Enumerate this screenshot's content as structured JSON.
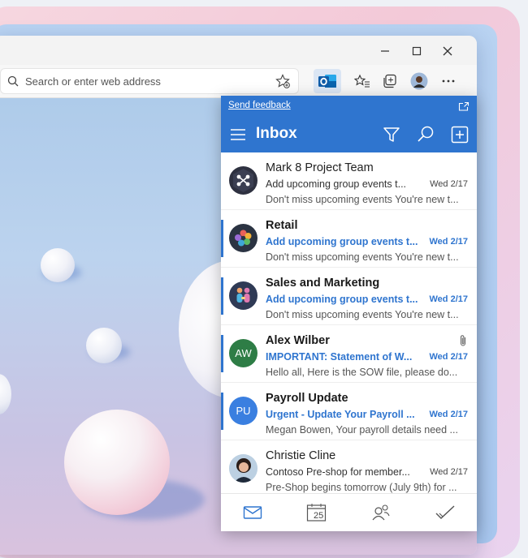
{
  "browser": {
    "address_placeholder": "Search or enter web address",
    "window_controls": [
      "minimize-icon",
      "maximize-icon",
      "close-icon"
    ],
    "toolbar_icons": [
      "outlook-extension-icon",
      "favorites-icon",
      "collections-icon",
      "profile-avatar",
      "more-icon"
    ]
  },
  "panel": {
    "feedback_link": "Send feedback",
    "title": "Inbox",
    "accent_color": "#2f75cf"
  },
  "mails": [
    {
      "sender": "Mark 8 Project Team",
      "subject": "Add upcoming group events t...",
      "date": "Wed 2/17",
      "preview": "Don't miss upcoming events You're new t...",
      "unread": false,
      "avatar": "team-logo",
      "initials": ""
    },
    {
      "sender": "Retail",
      "subject": "Add upcoming group events t...",
      "date": "Wed 2/17",
      "preview": "Don't miss upcoming events You're new t...",
      "unread": true,
      "avatar": "retail-logo",
      "initials": ""
    },
    {
      "sender": "Sales and Marketing",
      "subject": "Add upcoming group events t...",
      "date": "Wed 2/17",
      "preview": "Don't miss upcoming events You're new t...",
      "unread": true,
      "avatar": "sales-logo",
      "initials": ""
    },
    {
      "sender": "Alex Wilber",
      "subject": "IMPORTANT: Statement of W...",
      "date": "Wed 2/17",
      "preview": "Hello all, Here is the SOW file, please do...",
      "unread": true,
      "avatar": "initials",
      "initials": "AW",
      "avatar_color": "#2e7d46",
      "attachment": true
    },
    {
      "sender": "Payroll Update",
      "subject": "Urgent - Update Your Payroll ...",
      "date": "Wed 2/17",
      "preview": "Megan Bowen, Your payroll details need ...",
      "unread": true,
      "avatar": "initials",
      "initials": "PU",
      "avatar_color": "#3a7fe0"
    },
    {
      "sender": "Christie Cline",
      "subject": "Contoso Pre-shop for member...",
      "date": "Wed 2/17",
      "preview": "Pre-Shop begins tomorrow (July 9th) for ...",
      "unread": false,
      "avatar": "photo",
      "initials": ""
    }
  ],
  "bottom_nav": {
    "calendar_day": "25",
    "items": [
      "mail-icon",
      "calendar-icon",
      "people-icon",
      "tasks-icon"
    ]
  }
}
